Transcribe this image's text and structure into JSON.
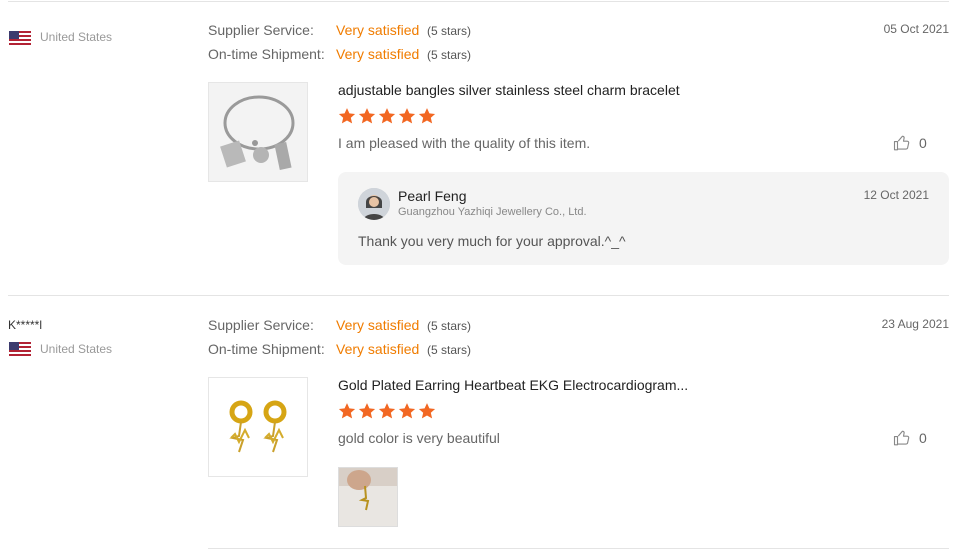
{
  "reviews": [
    {
      "buyer": "",
      "country": "United States",
      "supplier_service_label": "Supplier Service:",
      "supplier_service_value": "Very satisfied",
      "supplier_service_stars": "(5 stars)",
      "shipment_label": "On-time Shipment:",
      "shipment_value": "Very satisfied",
      "shipment_stars": "(5 stars)",
      "date": "05 Oct 2021",
      "product_title": "adjustable bangles silver stainless steel charm bracelet",
      "rating": 5,
      "comment": "I am pleased with the quality of this item.",
      "likes": "0",
      "reply": {
        "name": "Pearl Feng",
        "company": "Guangzhou Yazhiqi Jewellery Co., Ltd.",
        "date": "12 Oct 2021",
        "text": "Thank you very much for your approval.^_^"
      }
    },
    {
      "buyer": "K*****l",
      "country": "United States",
      "supplier_service_label": "Supplier Service:",
      "supplier_service_value": "Very satisfied",
      "supplier_service_stars": "(5 stars)",
      "shipment_label": "On-time Shipment:",
      "shipment_value": "Very satisfied",
      "shipment_stars": "(5 stars)",
      "date": "23 Aug 2021",
      "product_title": "Gold Plated Earring Heartbeat EKG Electrocardiogram...",
      "rating": 5,
      "comment": "gold color is very beautiful",
      "likes": "0"
    }
  ],
  "icons": {
    "flag": "us-flag-icon",
    "star": "star-icon",
    "like": "thumbs-up-icon"
  },
  "colors": {
    "accent": "#f07c00",
    "star": "#f26722",
    "reply_bg": "#f4f4f4"
  }
}
